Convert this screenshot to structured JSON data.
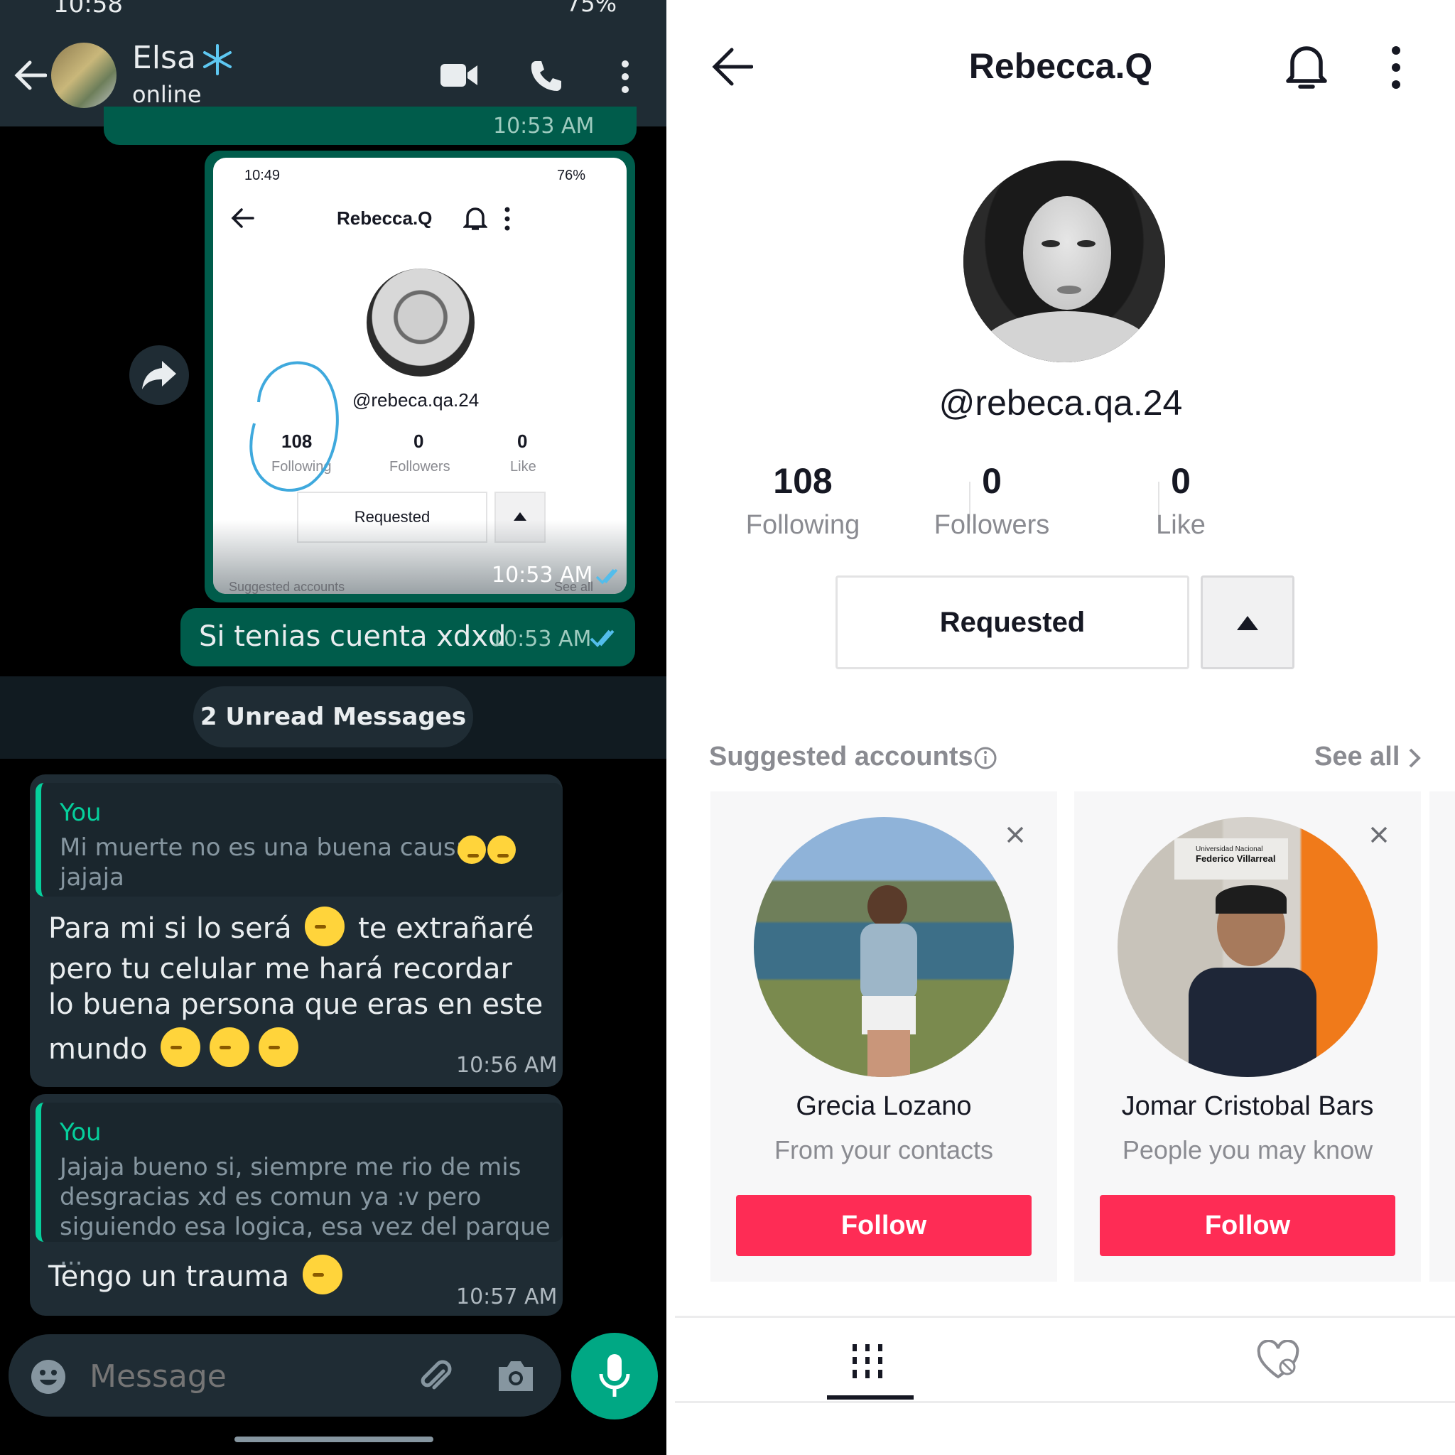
{
  "chat": {
    "status_bar": {
      "time": "10:58",
      "battery": "75%"
    },
    "contact": {
      "name": "Elsa",
      "status": "online"
    },
    "prev_time": "10:53 AM",
    "shared_screenshot": {
      "status_time": "10:49",
      "battery": "76%",
      "profile_title": "Rebecca.Q",
      "handle": "@rebeca.qa.24",
      "stats": [
        {
          "value": "108",
          "label": "Following"
        },
        {
          "value": "0",
          "label": "Followers"
        },
        {
          "value": "0",
          "label": "Like"
        }
      ],
      "requested": "Requested",
      "suggested": "Suggested accounts",
      "see_all": "See all",
      "time": "10:53 AM"
    },
    "outgoing_text": {
      "text": "Si tenias cuenta xdxd",
      "time": "10:53 AM"
    },
    "unread_banner": "2 Unread Messages",
    "incoming": [
      {
        "quote_author": "You",
        "quote_line1": "Mi muerte no es una buena causa",
        "quote_line2": "jajaja",
        "line1a": "Para mi si lo será",
        "line1b": "te extrañaré",
        "line2": "pero tu celular me hará recordar",
        "line3": "lo buena persona que eras en este",
        "line4": "mundo",
        "time": "10:56 AM"
      },
      {
        "quote_author": "You",
        "quote_line1": "Jajaja bueno si, siempre me rio de mis",
        "quote_line2": "desgracias xd es comun ya :v pero",
        "quote_line3": "siguiendo esa logica, esa vez del parque ...",
        "text": "Tengo un trauma",
        "time": "10:57 AM"
      }
    ],
    "composer_placeholder": "Message"
  },
  "profile": {
    "title": "Rebecca.Q",
    "handle": "@rebeca.qa.24",
    "stats": [
      {
        "value": "108",
        "label": "Following"
      },
      {
        "value": "0",
        "label": "Followers"
      },
      {
        "value": "0",
        "label": "Like"
      }
    ],
    "requested_label": "Requested",
    "suggested_label": "Suggested accounts",
    "see_all_label": "See all",
    "suggestions": [
      {
        "name": "Grecia Lozano",
        "reason": "From your contacts",
        "follow": "Follow"
      },
      {
        "name": "Jomar Cristobal Bars",
        "reason": "People you may know",
        "follow": "Follow",
        "photo_text_1": "Universidad Nacional",
        "photo_text_2": "Federico Villarreal"
      }
    ]
  },
  "colors": {
    "wa_green": "#005c4b",
    "wa_accent": "#00a884",
    "tiktok_red": "#fe2c55"
  }
}
